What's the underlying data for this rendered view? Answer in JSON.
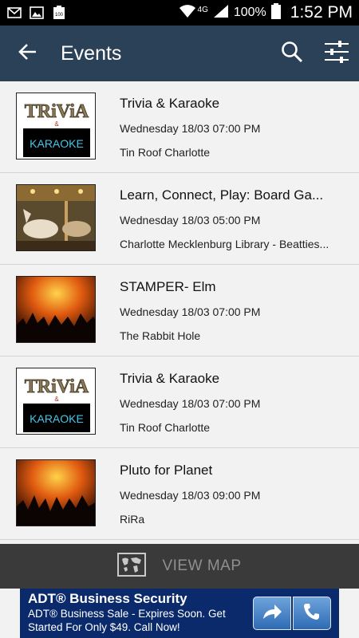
{
  "status_bar": {
    "network": "4G",
    "battery": "100%",
    "time": "1:52 PM",
    "left_icons": [
      "email-notification-icon",
      "image-notification-icon",
      "battery-full-notification-icon"
    ]
  },
  "app_bar": {
    "title": "Events",
    "back_icon": "arrow-left-icon",
    "search_icon": "search-icon",
    "filter_icon": "sliders-icon",
    "color": "#2b4157"
  },
  "events": [
    {
      "title": "Trivia & Karaoke",
      "datetime": "Wednesday 18/03 07:00 PM",
      "venue": "Tin Roof Charlotte",
      "image": "trivia-karaoke",
      "thumb_title": "TRiViA",
      "thumb_amp": "&",
      "thumb_sub": "KARAOKE"
    },
    {
      "title": "Learn, Connect, Play: Board Ga...",
      "datetime": "Wednesday 18/03 05:00 PM",
      "venue": "Charlotte Mecklenburg Library - Beatties...",
      "image": "carousel"
    },
    {
      "title": "STAMPER- Elm",
      "datetime": "Wednesday 18/03 07:00 PM",
      "venue": "The Rabbit Hole",
      "image": "concert"
    },
    {
      "title": "Trivia & Karaoke",
      "datetime": "Wednesday 18/03 07:00 PM",
      "venue": "Tin Roof Charlotte",
      "image": "trivia-karaoke",
      "thumb_title": "TRiViA",
      "thumb_amp": "&",
      "thumb_sub": "KARAOKE"
    },
    {
      "title": "Pluto for Planet",
      "datetime": "Wednesday 18/03 09:00 PM",
      "venue": "RiRa",
      "image": "concert"
    }
  ],
  "view_map": {
    "label": "VIEW MAP",
    "icon": "world-map-icon"
  },
  "ad": {
    "title": "ADT® Business Security",
    "body": "ADT® Business Sale - Expires Soon. Get Started For Only $49. Call Now!",
    "buttons": [
      "forward-arrow-icon",
      "phone-icon"
    ]
  }
}
